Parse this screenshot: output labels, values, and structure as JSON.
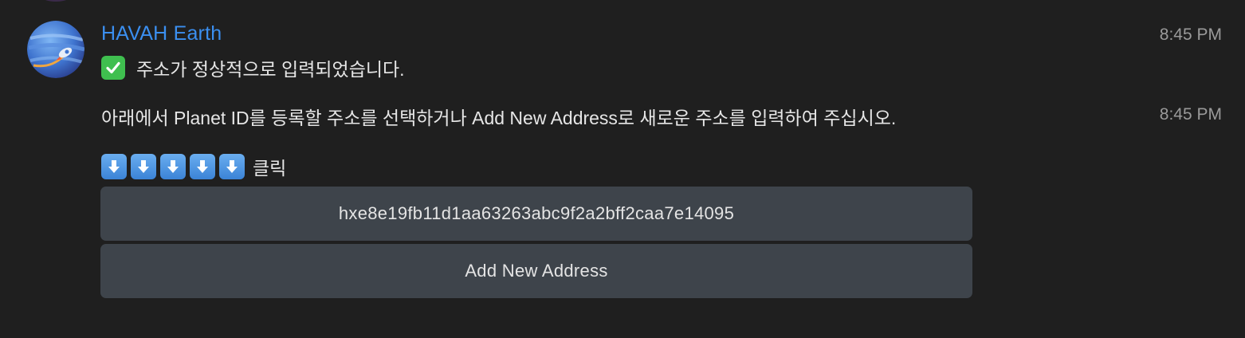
{
  "message": {
    "sender": "HAVAH Earth",
    "time_1": "8:45 PM",
    "time_2": "8:45 PM",
    "line_1": "주소가 정상적으로 입력되었습니다.",
    "line_2": "아래에서 Planet ID를 등록할 주소를 선택하거나 Add New Address로 새로운 주소를 입력하여 주십시오.",
    "line_3_label": "클릭"
  },
  "icons": {
    "check": "check-mark-button-icon",
    "arrow": "down-arrow-icon",
    "avatar": "planet-rocket-avatar"
  },
  "buttons": {
    "address": "hxe8e19fb11d1aa63263abc9f2a2bff2caa7e14095",
    "add_new": "Add New Address"
  },
  "colors": {
    "background": "#1f1f1f",
    "sender": "#3b8ff0",
    "button": "#3e444b",
    "check": "#3fbf4f",
    "arrow": "#4a90e2"
  }
}
